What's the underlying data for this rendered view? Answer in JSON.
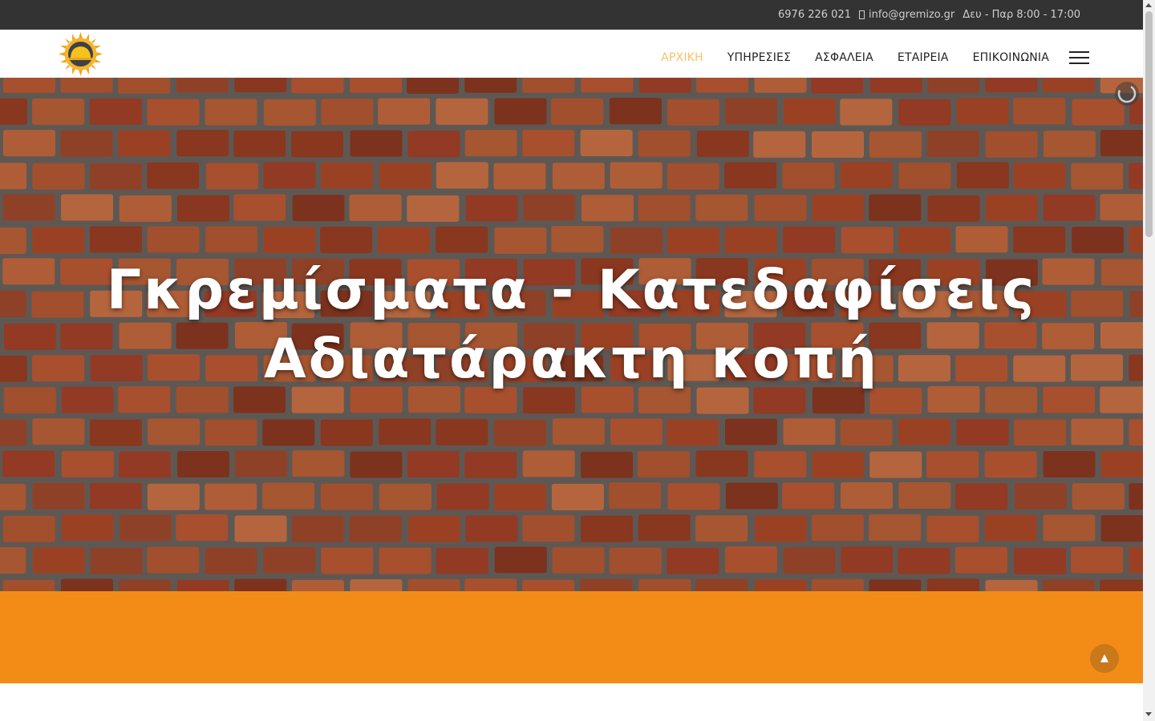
{
  "topbar": {
    "phone": "6976 226 021",
    "email": "info@gremizo.gr",
    "hours": "Δευ - Παρ 8:00 - 17:00",
    "email_icon": "envelope-icon"
  },
  "header": {
    "logo_icon": "sun-logo-icon",
    "nav": [
      {
        "label": "ΑΡΧΙΚΗ",
        "active": true
      },
      {
        "label": "ΥΠΗΡΕΣΙΕΣ",
        "active": false
      },
      {
        "label": "ΑΣΦΑΛΕΙΑ",
        "active": false
      },
      {
        "label": "ΕΤΑΙΡΕΙΑ",
        "active": false
      },
      {
        "label": "ΕΠΙΚΟΙΝΩΝΙΑ",
        "active": false
      }
    ],
    "menu_icon": "hamburger-menu-icon"
  },
  "hero": {
    "line1": "Γκρεμίσματα - Κατεδαφίσεις",
    "line2": "Αδιατάρακτη κοπή",
    "background": "brick-wall-image",
    "loader_icon": "loading-spinner-icon"
  },
  "band": {
    "back_to_top_icon": "chevron-up-icon"
  },
  "colors": {
    "topbar_bg": "#333333",
    "nav_active": "#f5c267",
    "band": "#f28c17",
    "brick": "#b5502e",
    "mortar": "#6b6560"
  }
}
